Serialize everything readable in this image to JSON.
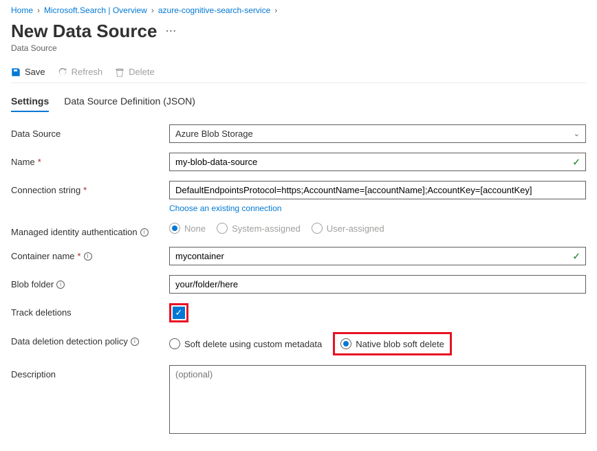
{
  "breadcrumb": {
    "items": [
      "Home",
      "Microsoft.Search | Overview",
      "azure-cognitive-search-service"
    ]
  },
  "header": {
    "title": "New Data Source",
    "subtitle": "Data Source"
  },
  "toolbar": {
    "save": "Save",
    "refresh": "Refresh",
    "delete": "Delete"
  },
  "tabs": {
    "settings": "Settings",
    "json": "Data Source Definition (JSON)"
  },
  "form": {
    "dataSource": {
      "label": "Data Source",
      "value": "Azure Blob Storage"
    },
    "name": {
      "label": "Name",
      "value": "my-blob-data-source"
    },
    "conn": {
      "label": "Connection string",
      "value": "DefaultEndpointsProtocol=https;AccountName=[accountName];AccountKey=[accountKey]",
      "link": "Choose an existing connection"
    },
    "mia": {
      "label": "Managed identity authentication",
      "opts": [
        "None",
        "System-assigned",
        "User-assigned"
      ]
    },
    "container": {
      "label": "Container name",
      "value": "mycontainer"
    },
    "blobFolder": {
      "label": "Blob folder",
      "value": "your/folder/here"
    },
    "track": {
      "label": "Track deletions"
    },
    "policy": {
      "label": "Data deletion detection policy",
      "opts": [
        "Soft delete using custom metadata",
        "Native blob soft delete"
      ]
    },
    "description": {
      "label": "Description",
      "placeholder": "(optional)"
    }
  }
}
